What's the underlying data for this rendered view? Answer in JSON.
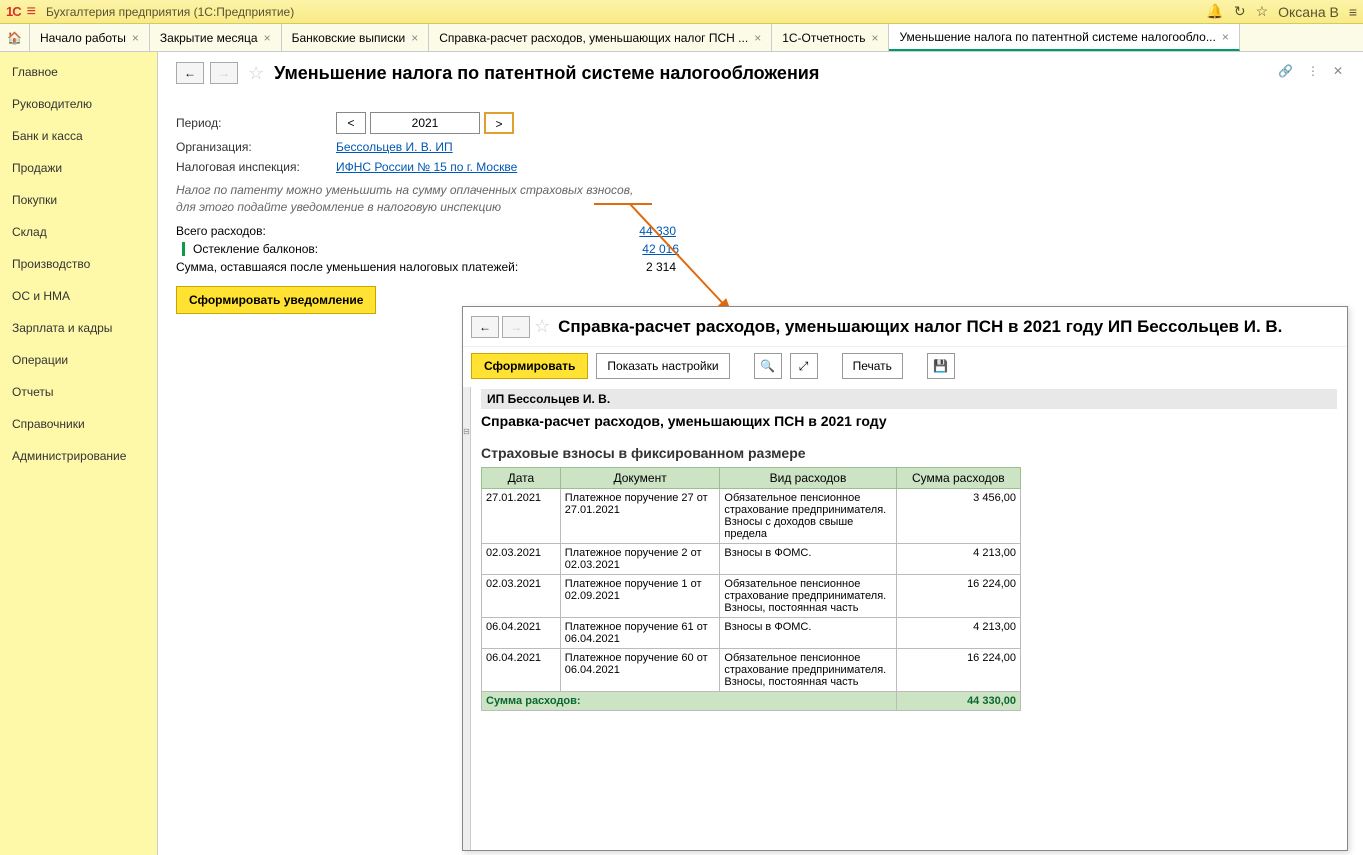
{
  "titlebar": {
    "app": "Бухгалтерия предприятия  (1С:Предприятие)",
    "user": "Оксана В"
  },
  "tabs": [
    {
      "label": "Начало работы"
    },
    {
      "label": "Закрытие месяца"
    },
    {
      "label": "Банковские выписки"
    },
    {
      "label": "Справка-расчет расходов, уменьшающих налог ПСН ..."
    },
    {
      "label": "1С-Отчетность"
    },
    {
      "label": "Уменьшение налога по патентной системе налогообло...",
      "active": true
    }
  ],
  "sidebar": [
    "Главное",
    "Руководителю",
    "Банк и касса",
    "Продажи",
    "Покупки",
    "Склад",
    "Производство",
    "ОС и НМА",
    "Зарплата и кадры",
    "Операции",
    "Отчеты",
    "Справочники",
    "Администрирование"
  ],
  "page": {
    "title": "Уменьшение налога по патентной системе налогообложения",
    "period_label": "Период:",
    "period_value": "2021",
    "org_label": "Организация:",
    "org_value": "Бессольцев И. В. ИП",
    "tax_label": "Налоговая инспекция:",
    "tax_value": "ИФНС России № 15 по г. Москве",
    "hint1": "Налог по патенту можно уменьшить на сумму оплаченных страховых взносов,",
    "hint2": "для этого подайте уведомление в налоговую инспекцию",
    "total_label": "Всего расходов:",
    "total_value": "44 330",
    "item_label": "Остекление балконов:",
    "item_value": "42 016",
    "remain_label": "Сумма, оставшаяся после уменьшения налоговых платежей:",
    "remain_value": "2 314",
    "button": "Сформировать уведомление"
  },
  "popup": {
    "title": "Справка-расчет расходов, уменьшающих налог ПСН в 2021 году ИП Бессольцев И. В.",
    "btn_generate": "Сформировать",
    "btn_settings": "Показать настройки",
    "btn_print": "Печать",
    "org": "ИП Бессольцев И. В.",
    "report_title": "Справка-расчет расходов, уменьшающих ПСН в 2021 году",
    "section": "Страховые взносы в фиксированном размере",
    "headers": {
      "date": "Дата",
      "doc": "Документ",
      "type": "Вид расходов",
      "sum": "Сумма расходов"
    },
    "rows": [
      {
        "date": "27.01.2021",
        "doc": "Платежное поручение 27 от 27.01.2021",
        "type": "Обязательное пенсионное страхование предпринимателя. Взносы с доходов свыше предела",
        "sum": "3 456,00"
      },
      {
        "date": "02.03.2021",
        "doc": "Платежное поручение 2 от 02.03.2021",
        "type": "Взносы в ФОМС.",
        "sum": "4 213,00"
      },
      {
        "date": "02.03.2021",
        "doc": "Платежное поручение 1 от 02.09.2021",
        "type": "Обязательное пенсионное страхование предпринимателя. Взносы, постоянная часть",
        "sum": "16 224,00"
      },
      {
        "date": "06.04.2021",
        "doc": "Платежное поручение 61 от 06.04.2021",
        "type": "Взносы в ФОМС.",
        "sum": "4 213,00"
      },
      {
        "date": "06.04.2021",
        "doc": "Платежное поручение 60 от 06.04.2021",
        "type": "Обязательное пенсионное страхование предпринимателя. Взносы, постоянная часть",
        "sum": "16 224,00"
      }
    ],
    "total_label": "Сумма расходов:",
    "total_value": "44 330,00"
  }
}
